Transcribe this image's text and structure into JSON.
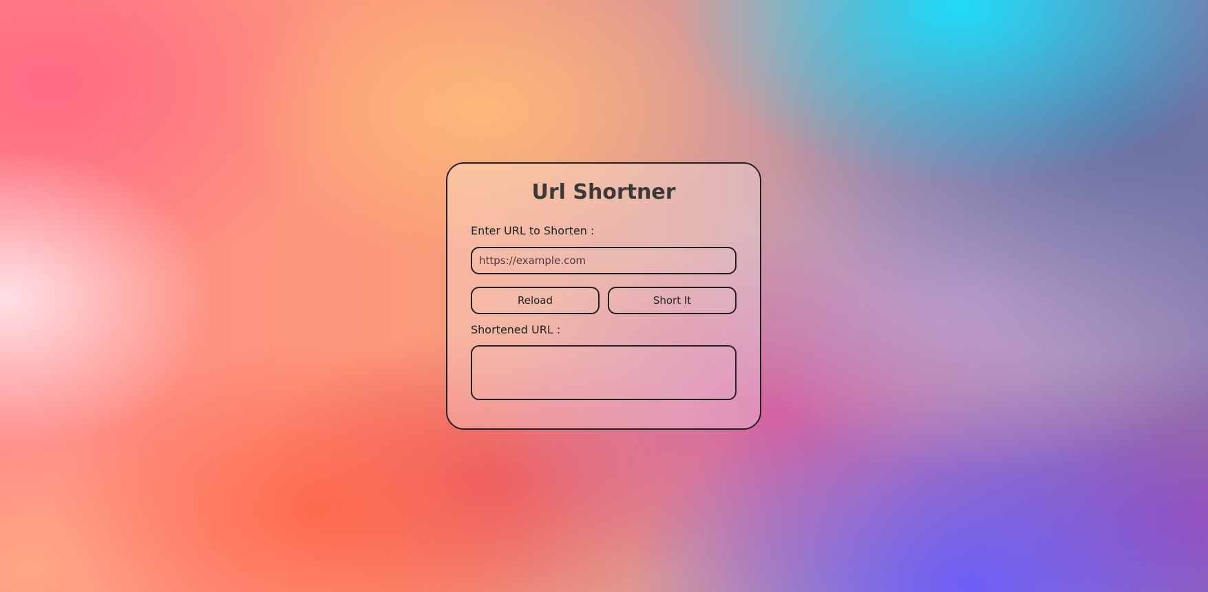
{
  "app": {
    "title": "Url Shortner"
  },
  "form": {
    "input_label": "Enter URL to Shorten :",
    "input_placeholder": "https://example.com",
    "input_value": "",
    "reload_label": "Reload",
    "shorten_label": "Short It",
    "output_label": "Shortened URL :",
    "output_value": ""
  },
  "colors": {
    "border": "#1f1f1f",
    "title": "#3a3a3a",
    "text": "#222222"
  }
}
